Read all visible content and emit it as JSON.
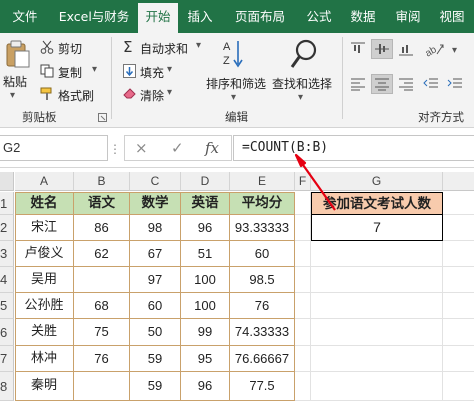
{
  "ribbon_tabs": {
    "file": "文件",
    "excel_finance": "Excel与财务",
    "home": "开始",
    "insert": "插入",
    "page_layout": "页面布局",
    "formulas": "公式",
    "data": "数据",
    "review": "审阅",
    "view": "视图"
  },
  "clipboard": {
    "paste": "粘贴",
    "cut": "剪切",
    "copy": "复制",
    "format_painter": "格式刷",
    "group_label": "剪贴板"
  },
  "editing": {
    "autosum": "自动求和",
    "fill": "填充",
    "clear": "清除",
    "sort_filter": "排序和筛选",
    "find_select": "查找和选择",
    "group_label": "编辑"
  },
  "alignment": {
    "group_label": "对齐方式"
  },
  "formula_bar": {
    "name_box": "G2",
    "cancel_symbol": "×",
    "enter_symbol": "✓",
    "fx_symbol": "fx",
    "formula": "=COUNT(B:B)"
  },
  "grid": {
    "columns": [
      "A",
      "B",
      "C",
      "D",
      "E",
      "F",
      "G"
    ],
    "rows": [
      "1",
      "2",
      "3",
      "4",
      "5",
      "6",
      "7",
      "8"
    ],
    "table_headers": [
      "姓名",
      "语文",
      "数学",
      "英语",
      "平均分"
    ],
    "table_rows": [
      [
        "宋江",
        "86",
        "98",
        "96",
        "93.33333"
      ],
      [
        "卢俊义",
        "62",
        "67",
        "51",
        "60"
      ],
      [
        "吴用",
        "",
        "97",
        "100",
        "98.5"
      ],
      [
        "公孙胜",
        "68",
        "60",
        "100",
        "76"
      ],
      [
        "关胜",
        "75",
        "50",
        "99",
        "74.33333"
      ],
      [
        "林冲",
        "76",
        "59",
        "95",
        "76.66667"
      ],
      [
        "秦明",
        "",
        "59",
        "96",
        "77.5"
      ]
    ],
    "result_header": "参加语文考试人数",
    "result_value": "7"
  },
  "colors": {
    "ribbon_green": "#217346",
    "table_header_fill": "#c6e0b4",
    "result_header_fill": "#f8cbad",
    "annotation_arrow": "#e60012"
  }
}
